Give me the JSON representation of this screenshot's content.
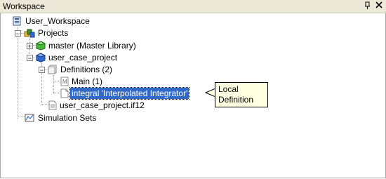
{
  "window": {
    "title": "Workspace",
    "pin_glyph": "ⅅ",
    "close_glyph": "×"
  },
  "tree": {
    "root": "User_Workspace",
    "projects": "Projects",
    "master": "master (Master Library)",
    "project": "user_case_project",
    "definitions": "Definitions (2)",
    "main": "Main (1)",
    "integral": "integral 'Interpolated Integrator'",
    "file": "user_case_project.if12",
    "simulation_sets": "Simulation Sets"
  },
  "callout": {
    "line1": "Local",
    "line2": "Definition"
  },
  "expander_minus": "−",
  "expander_plus": "+"
}
